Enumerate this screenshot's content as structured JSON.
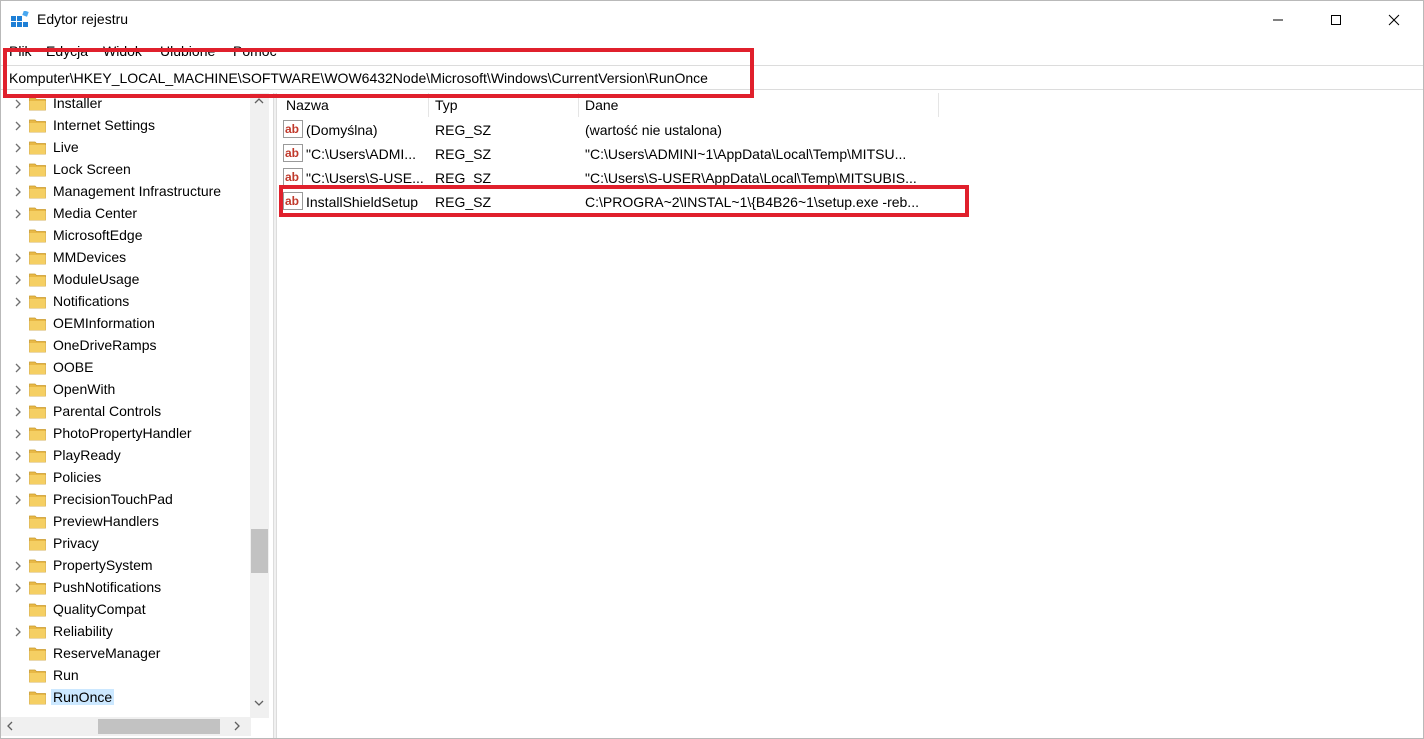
{
  "window": {
    "title": "Edytor rejestru",
    "controls": [
      "minimize",
      "maximize",
      "close"
    ]
  },
  "menu": [
    "Plik",
    "Edycja",
    "Widok",
    "Ulubione",
    "Pomoc"
  ],
  "address": "Komputer\\HKEY_LOCAL_MACHINE\\SOFTWARE\\WOW6432Node\\Microsoft\\Windows\\CurrentVersion\\RunOnce",
  "tree": {
    "items": [
      {
        "label": "Installer",
        "expandable": true
      },
      {
        "label": "Internet Settings",
        "expandable": true
      },
      {
        "label": "Live",
        "expandable": true
      },
      {
        "label": "Lock Screen",
        "expandable": true
      },
      {
        "label": "Management Infrastructure",
        "expandable": true
      },
      {
        "label": "Media Center",
        "expandable": true
      },
      {
        "label": "MicrosoftEdge",
        "expandable": false
      },
      {
        "label": "MMDevices",
        "expandable": true
      },
      {
        "label": "ModuleUsage",
        "expandable": true
      },
      {
        "label": "Notifications",
        "expandable": true
      },
      {
        "label": "OEMInformation",
        "expandable": false
      },
      {
        "label": "OneDriveRamps",
        "expandable": false
      },
      {
        "label": "OOBE",
        "expandable": true
      },
      {
        "label": "OpenWith",
        "expandable": true
      },
      {
        "label": "Parental Controls",
        "expandable": true
      },
      {
        "label": "PhotoPropertyHandler",
        "expandable": true
      },
      {
        "label": "PlayReady",
        "expandable": true
      },
      {
        "label": "Policies",
        "expandable": true
      },
      {
        "label": "PrecisionTouchPad",
        "expandable": true
      },
      {
        "label": "PreviewHandlers",
        "expandable": false
      },
      {
        "label": "Privacy",
        "expandable": false
      },
      {
        "label": "PropertySystem",
        "expandable": true
      },
      {
        "label": "PushNotifications",
        "expandable": true
      },
      {
        "label": "QualityCompat",
        "expandable": false
      },
      {
        "label": "Reliability",
        "expandable": true
      },
      {
        "label": "ReserveManager",
        "expandable": false
      },
      {
        "label": "Run",
        "expandable": false
      },
      {
        "label": "RunOnce",
        "expandable": false,
        "selected": true
      }
    ]
  },
  "list": {
    "columns": [
      "Nazwa",
      "Typ",
      "Dane"
    ],
    "rows": [
      {
        "name": "(Domyślna)",
        "type": "REG_SZ",
        "data": "(wartość nie ustalona)"
      },
      {
        "name": "\"C:\\Users\\ADMI...",
        "type": "REG_SZ",
        "data": "\"C:\\Users\\ADMINI~1\\AppData\\Local\\Temp\\MITSU..."
      },
      {
        "name": "\"C:\\Users\\S-USE...",
        "type": "REG_SZ",
        "data": "\"C:\\Users\\S-USER\\AppData\\Local\\Temp\\MITSUBIS..."
      },
      {
        "name": "InstallShieldSetup",
        "type": "REG_SZ",
        "data": "C:\\PROGRA~2\\INSTAL~1\\{B4B26~1\\setup.exe -reb..."
      }
    ]
  },
  "colors": {
    "highlight": "#e0202c",
    "selection": "#cce8ff",
    "folder": "#e8b845"
  }
}
